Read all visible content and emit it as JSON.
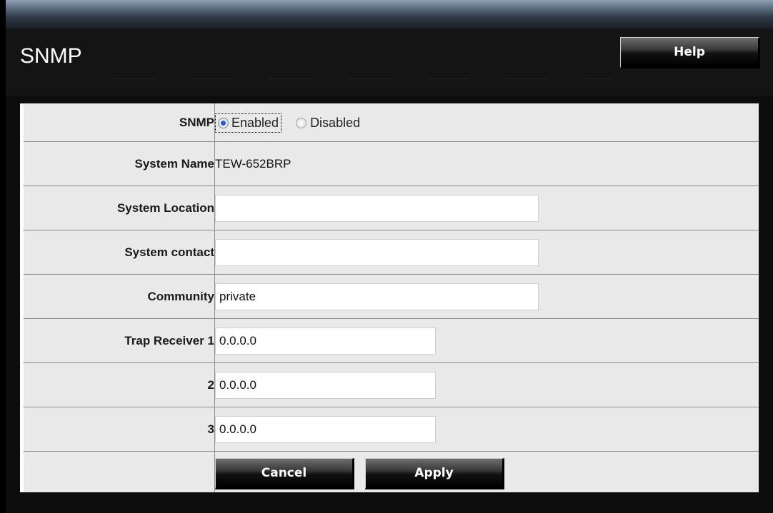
{
  "page": {
    "title": "SNMP",
    "help_label": "Help"
  },
  "form": {
    "snmp": {
      "label": "SNMP",
      "enabled_label": "Enabled",
      "disabled_label": "Disabled",
      "selected": "Enabled"
    },
    "system_name": {
      "label": "System Name",
      "value": "TEW-652BRP"
    },
    "system_location": {
      "label": "System Location",
      "value": ""
    },
    "system_contact": {
      "label": "System contact",
      "value": ""
    },
    "community": {
      "label": "Community",
      "value": "private"
    },
    "trap_receiver_1": {
      "label": "Trap Receiver 1",
      "value": "0.0.0.0"
    },
    "trap_receiver_2": {
      "label": "2",
      "value": "0.0.0.0"
    },
    "trap_receiver_3": {
      "label": "3",
      "value": "0.0.0.0"
    }
  },
  "actions": {
    "cancel_label": "Cancel",
    "apply_label": "Apply"
  },
  "colors": {
    "header_bg": "#141414",
    "form_bg": "#e9e9e9",
    "radio_selected": "#2a5bd7"
  }
}
